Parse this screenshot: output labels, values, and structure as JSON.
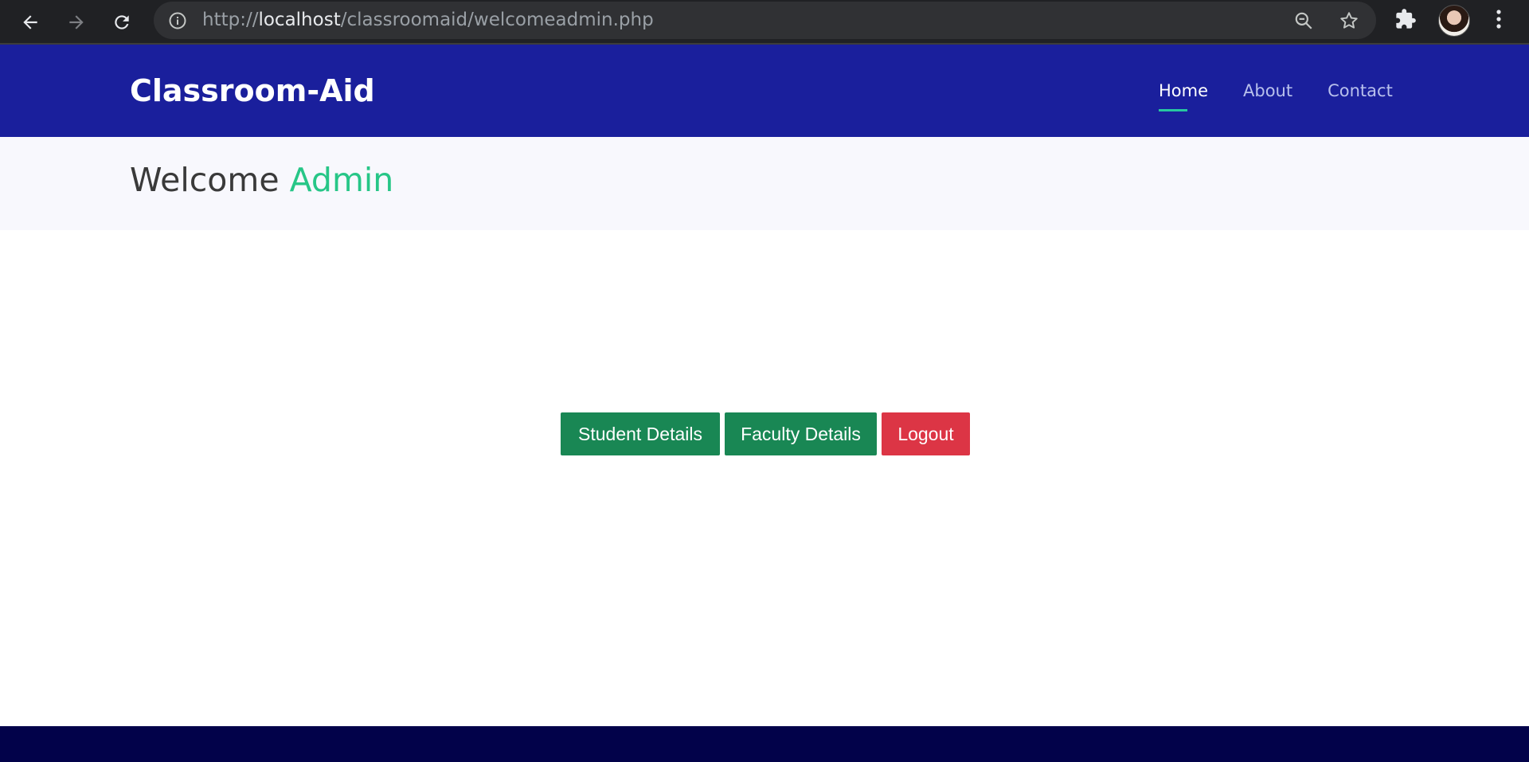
{
  "browser": {
    "url_scheme": "http://",
    "url_host": "localhost",
    "url_path": "/classroomaid/welcomeadmin.php"
  },
  "header": {
    "brand": "Classroom-Aid",
    "nav": [
      {
        "label": "Home",
        "active": true
      },
      {
        "label": "About",
        "active": false
      },
      {
        "label": "Contact",
        "active": false
      }
    ]
  },
  "welcome": {
    "prefix": "Welcome",
    "name": "Admin"
  },
  "actions": {
    "student_label": "Student Details",
    "faculty_label": "Faculty Details",
    "logout_label": "Logout"
  },
  "colors": {
    "header_bg": "#1a1f9c",
    "accent_teal": "#27c6a0",
    "accent_green": "#27c687",
    "button_green": "#198754",
    "button_red": "#dc3545",
    "footer_bg": "#02024a"
  }
}
